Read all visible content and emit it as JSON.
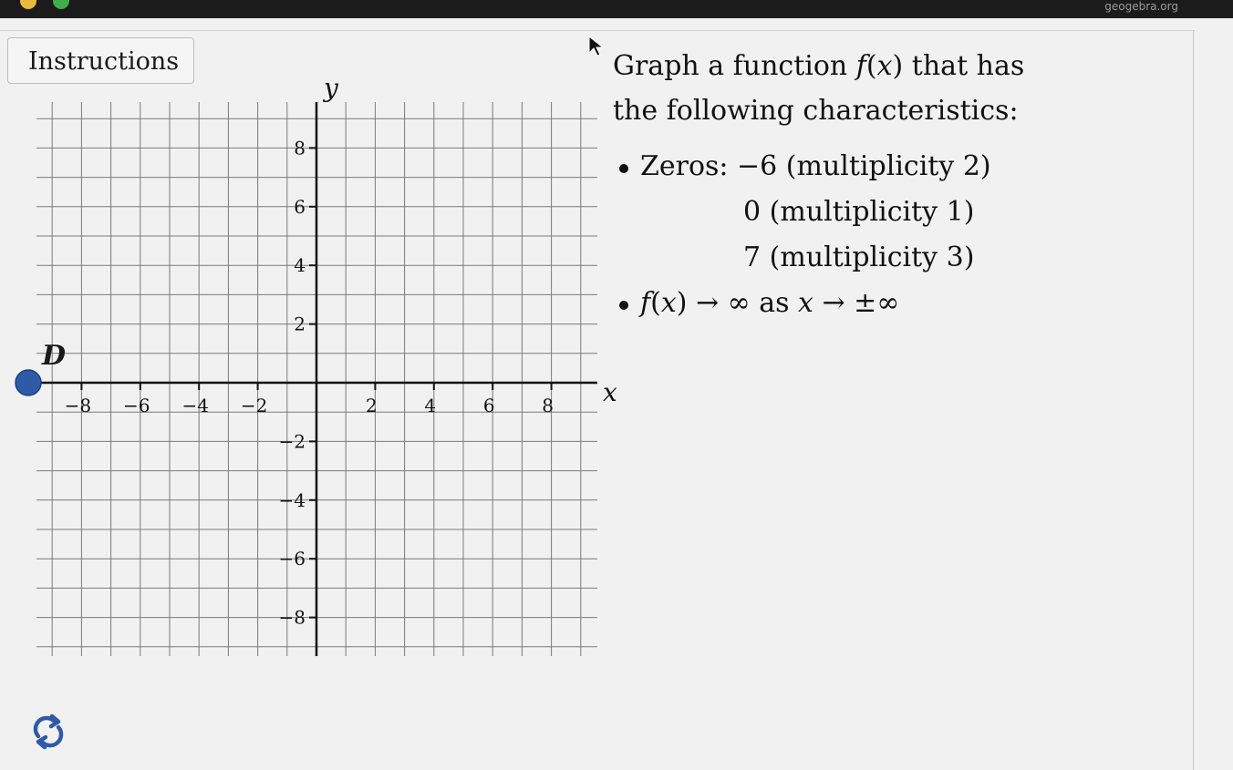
{
  "toolbar": {
    "instructions_label": "Instructions"
  },
  "topbar": {
    "url": "geogebra.org"
  },
  "problem": {
    "line1_before": "Graph a function ",
    "line1_fn": "f",
    "line1_open": "(",
    "line1_var": "x",
    "line1_close": ")",
    "line1_after": " that has",
    "line2": "the following characteristics:",
    "zeros_label": "Zeros: −6 (multiplicity 2)",
    "zero_2": "0 (multiplicity 1)",
    "zero_3": "7 (multiplicity 3)",
    "end_behavior_fn": "f",
    "end_behavior_paren_open": "(",
    "end_behavior_var": "x",
    "end_behavior_paren_close": ")",
    "end_behavior_arrow": " → ∞ as ",
    "end_behavior_var2": "x",
    "end_behavior_tail": " → ±∞"
  },
  "graph": {
    "x_axis_label": "x",
    "y_axis_label": "y",
    "x_ticks": [
      "−8",
      "−6",
      "−4",
      "−2",
      "2",
      "4",
      "6",
      "8"
    ],
    "y_ticks": [
      "8",
      "6",
      "4",
      "2",
      "−2",
      "−4",
      "−6",
      "−8"
    ],
    "x_tick_values": [
      -8,
      -6,
      -4,
      -2,
      2,
      4,
      6,
      8
    ],
    "y_tick_values": [
      8,
      6,
      4,
      2,
      -2,
      -4,
      -6,
      -8
    ],
    "x_range": [
      -9,
      9
    ],
    "y_range": [
      -9,
      9.5
    ],
    "grid_step": 1,
    "point_label": "D",
    "point_color": "#2f5aa8"
  },
  "colors": {
    "grid": "#7a7a7a",
    "axis": "#111111",
    "panel": "#f1f1f1"
  }
}
